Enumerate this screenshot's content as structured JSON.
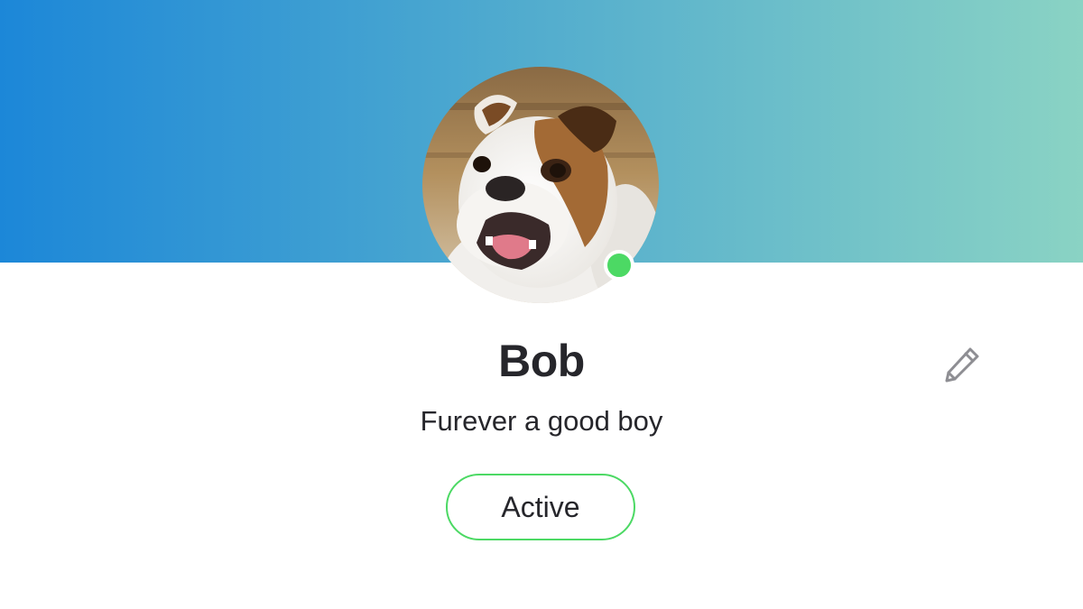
{
  "profile": {
    "name": "Bob",
    "bio": "Furever a good boy",
    "status_label": "Active",
    "online": true
  },
  "avatar": {
    "subject": "bulldog photo"
  },
  "icons": {
    "edit": "pencil-icon",
    "presence": "online-status-dot"
  },
  "colors": {
    "banner_gradient_start": "#1c87d8",
    "banner_gradient_end": "#8ad3c4",
    "online_green": "#4cd964",
    "text_primary": "#26262b",
    "icon_gray": "#8e8e93"
  }
}
